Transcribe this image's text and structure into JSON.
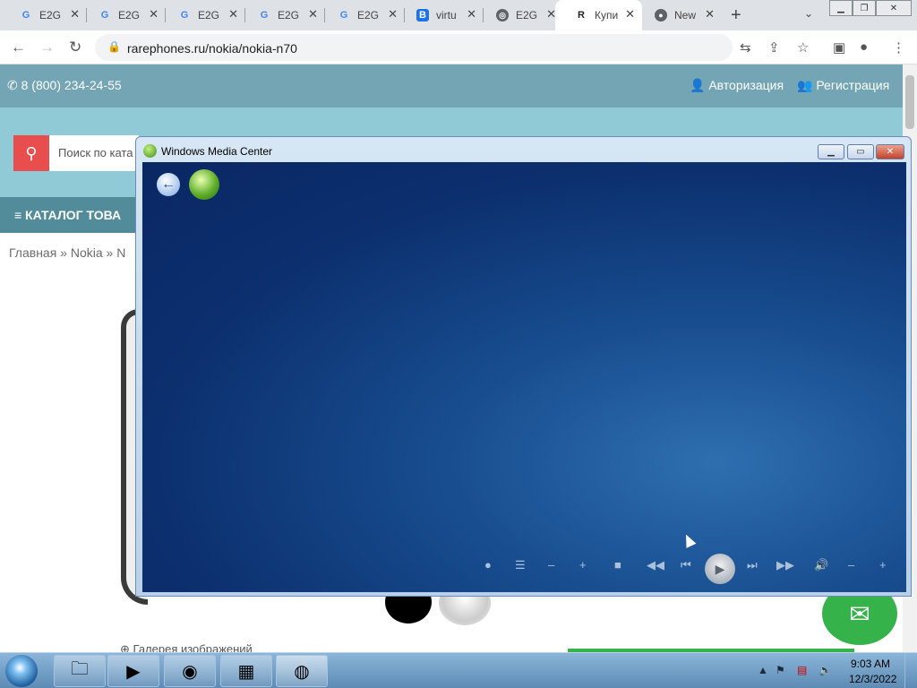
{
  "browser": {
    "tabs": [
      {
        "label": "E2G",
        "favicon": "G"
      },
      {
        "label": "E2G",
        "favicon": "G"
      },
      {
        "label": "E2G",
        "favicon": "G"
      },
      {
        "label": "E2G",
        "favicon": "G"
      },
      {
        "label": "E2G",
        "favicon": "G"
      },
      {
        "label": "virtu",
        "favicon": "B"
      },
      {
        "label": "E2G",
        "favicon": "globe"
      },
      {
        "label": "Купи",
        "favicon": "R",
        "active": true
      },
      {
        "label": "New",
        "favicon": "chrome"
      }
    ],
    "url": "rarephones.ru/nokia/nokia-n70"
  },
  "site": {
    "phone": "8 (800) 234-24-55",
    "login": "Авторизация",
    "register": "Регистрация",
    "search_placeholder": "Поиск по ката",
    "catalog": "≡ КАТАЛОГ ТОВА",
    "breadcrumb": "Главная » Nokia » N",
    "gallery": "Галерея изображений"
  },
  "media_center": {
    "title": "Windows Media Center"
  },
  "taskbar": {
    "time": "9:03 AM",
    "date": "12/3/2022"
  },
  "colors": {
    "site_header": "#74a5b4",
    "site_hero": "#8fcad6",
    "search_button": "#e84e4e",
    "wmc_background": "#0c2f6e",
    "taskbar": "#5d8bb5"
  }
}
